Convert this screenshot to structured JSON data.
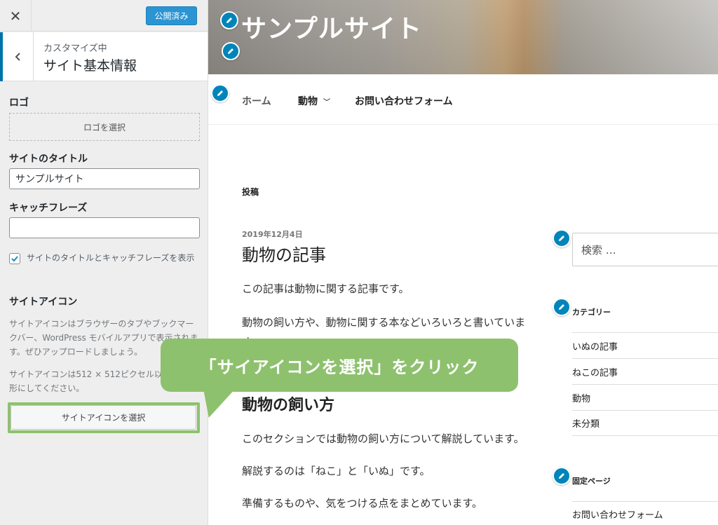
{
  "sidebar": {
    "close_glyph": "✕",
    "publish_label": "公開済み",
    "header": {
      "sub": "カスタマイズ中",
      "title": "サイト基本情報"
    },
    "logo": {
      "label": "ロゴ",
      "button": "ロゴを選択"
    },
    "site_title": {
      "label": "サイトのタイトル",
      "value": "サンプルサイト"
    },
    "tagline": {
      "label": "キャッチフレーズ",
      "value": ""
    },
    "display_toggle": {
      "checked": true,
      "label": "サイトのタイトルとキャッチフレーズを表示"
    },
    "site_icon": {
      "label": "サイトアイコン",
      "desc1": "サイトアイコンはブラウザーのタブやブックマークバー、WordPress モバイルアプリで表示されます。ぜひアップロードしましょう。",
      "desc2": "サイトアイコンは512 × 512ピクセル以上の正方形にしてください。",
      "button": "サイトアイコンを選択"
    }
  },
  "preview": {
    "site_title": "サンプルサイト",
    "nav": [
      {
        "label": "ホーム"
      },
      {
        "label": "動物"
      },
      {
        "label": "お問い合わせフォーム"
      }
    ],
    "section_label": "投稿",
    "post": {
      "date": "2019年12月4日",
      "title": "動物の記事",
      "p1": "この記事は動物に関する記事です。",
      "p2": "動物の飼い方や、動物に関する本などいろいろと書いています。",
      "heading": "動物の飼い方",
      "p3": "このセクションでは動物の飼い方について解説しています。",
      "p4": "解説するのは「ねこ」と「いぬ」です。",
      "p5": "準備するものや、気をつける点をまとめています。"
    },
    "search_placeholder": "検索 …",
    "categories": {
      "title": "カテゴリー",
      "items": [
        "いぬの記事",
        "ねこの記事",
        "動物",
        "未分類"
      ]
    },
    "pages": {
      "title": "固定ページ",
      "items": [
        "お問い合わせフォーム"
      ]
    }
  },
  "callout": {
    "text": "「サイアイコンを選択」をクリック"
  },
  "colors": {
    "accent": "#0085ba",
    "publish": "#2b95d3",
    "callout": "#8ec16e"
  }
}
